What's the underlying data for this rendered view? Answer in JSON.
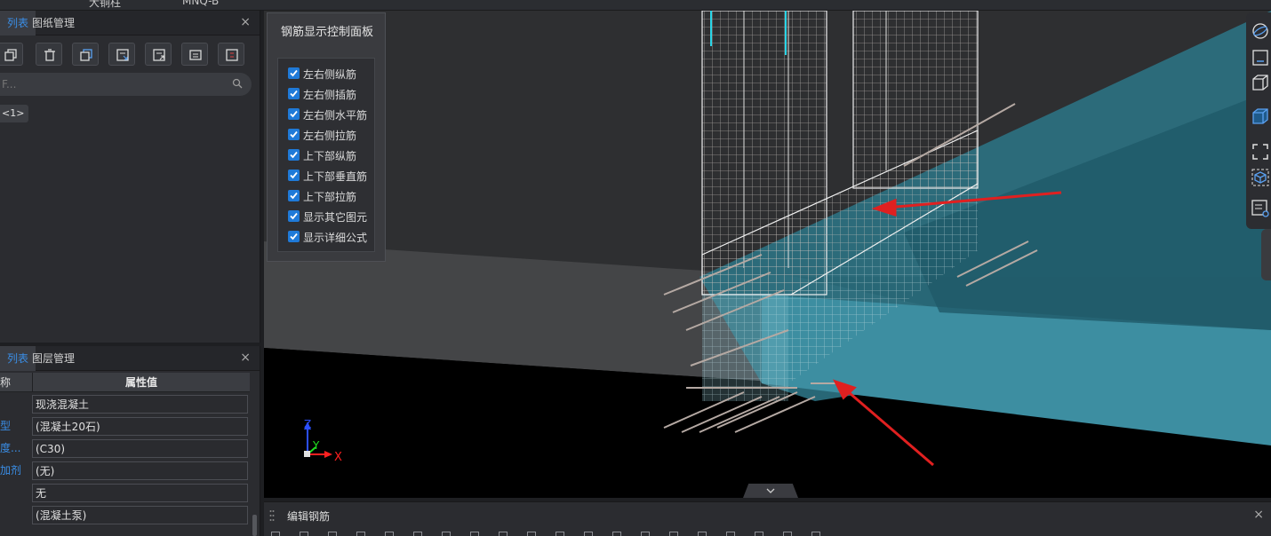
{
  "top_bar": {
    "tab_a": "大铜柱",
    "tab_b": "MNQ-B"
  },
  "left_top": {
    "tab_active": "列表",
    "tab_other": "图纸管理",
    "close": "×",
    "search_placeholder": "F...",
    "tag": "<1>",
    "toolbar_icons": [
      "copy-icon",
      "delete-icon",
      "duplicate-icon",
      "import-icon",
      "export-icon",
      "list-icon",
      "split-icon"
    ]
  },
  "left_bottom": {
    "tab_active": "列表",
    "tab_other": "图层管理",
    "close": "×",
    "header_name": "称",
    "header_value": "属性值",
    "rows": [
      {
        "key": "",
        "value": "现浇混凝土"
      },
      {
        "key": "型",
        "value": "(混凝土20石)"
      },
      {
        "key": "度...",
        "value": "(C30)"
      },
      {
        "key": "加剂",
        "value": "(无)"
      },
      {
        "key": "",
        "value": "无"
      },
      {
        "key": "",
        "value": "(混凝土泵)"
      }
    ]
  },
  "control_panel": {
    "title": "钢筋显示控制面板",
    "options": [
      {
        "label": "左右侧纵筋",
        "checked": true
      },
      {
        "label": "左右侧插筋",
        "checked": true
      },
      {
        "label": "左右侧水平筋",
        "checked": true
      },
      {
        "label": "左右侧拉筋",
        "checked": true
      },
      {
        "label": "上下部纵筋",
        "checked": true
      },
      {
        "label": "上下部垂直筋",
        "checked": true
      },
      {
        "label": "上下部拉筋",
        "checked": true
      },
      {
        "label": "显示其它图元",
        "checked": true
      },
      {
        "label": "显示详细公式",
        "checked": true
      }
    ]
  },
  "axes": {
    "z": "Z",
    "y": "Y",
    "x": "X"
  },
  "right_toolbar_icons": [
    "sphere-view-icon",
    "2d-view-icon",
    "3d-box-icon",
    "3d-solid-icon",
    "fit-view-icon",
    "cube-select-icon",
    "property-list-icon"
  ],
  "bottom_panel": {
    "title": "编辑钢筋",
    "close": "×"
  },
  "colors": {
    "accent": "#1f7ad8",
    "highlight": "#3a8ee6",
    "arrow": "#e02020",
    "cyan_face": "#3e8fa3"
  }
}
